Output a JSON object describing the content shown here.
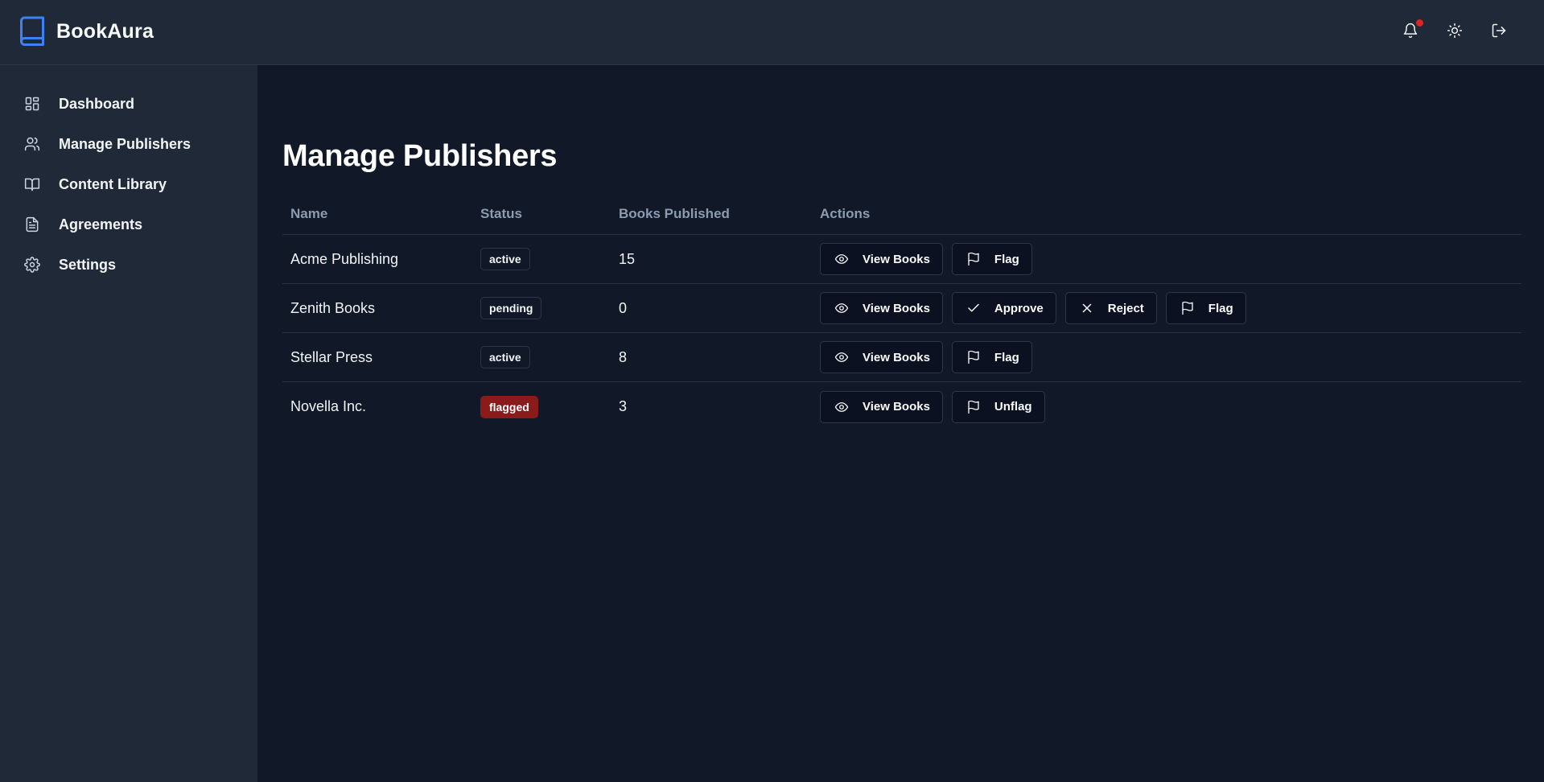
{
  "app": {
    "name": "BookAura"
  },
  "header": {
    "notification_icon": "bell-icon",
    "theme_icon": "sun-icon",
    "logout_icon": "logout-icon",
    "notification_dot_color": "#dc2626"
  },
  "sidebar": {
    "items": [
      {
        "label": "Dashboard",
        "icon": "grid-icon"
      },
      {
        "label": "Manage Publishers",
        "icon": "users-icon"
      },
      {
        "label": "Content Library",
        "icon": "book-open-icon"
      },
      {
        "label": "Agreements",
        "icon": "file-text-icon"
      },
      {
        "label": "Settings",
        "icon": "gear-icon"
      }
    ]
  },
  "main": {
    "title": "Manage Publishers",
    "table": {
      "headers": [
        "Name",
        "Status",
        "Books Published",
        "Actions"
      ],
      "rows": [
        {
          "name": "Acme Publishing",
          "status": "active",
          "books": "15",
          "actions": [
            "View Books",
            "Flag"
          ]
        },
        {
          "name": "Zenith Books",
          "status": "pending",
          "books": "0",
          "actions": [
            "View Books",
            "Approve",
            "Reject",
            "Flag"
          ]
        },
        {
          "name": "Stellar Press",
          "status": "active",
          "books": "8",
          "actions": [
            "View Books",
            "Flag"
          ]
        },
        {
          "name": "Novella Inc.",
          "status": "flagged",
          "books": "3",
          "actions": [
            "View Books",
            "Unflag"
          ]
        }
      ]
    }
  },
  "colors": {
    "accent": "#3b82f6",
    "flagged_badge": "#8b1a1a",
    "background": "#111827",
    "sidebar": "#1f2937"
  }
}
